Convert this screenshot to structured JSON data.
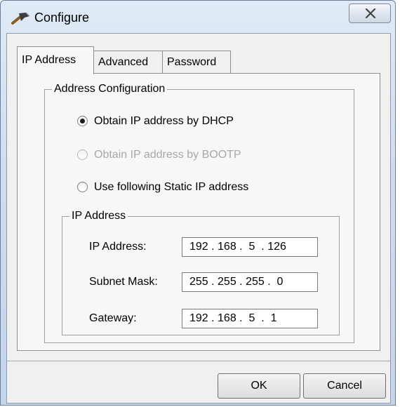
{
  "window": {
    "title": "Configure",
    "icon": "hammer-icon",
    "close_icon": "close-icon"
  },
  "tabs": [
    {
      "label": "IP Address",
      "active": true
    },
    {
      "label": "Advanced",
      "active": false
    },
    {
      "label": "Password",
      "active": false
    }
  ],
  "address_config": {
    "legend": "Address Configuration",
    "options": [
      {
        "label": "Obtain IP address by DHCP",
        "checked": true,
        "enabled": true
      },
      {
        "label": "Obtain IP address by BOOTP",
        "checked": false,
        "enabled": false
      },
      {
        "label": "Use following Static IP address",
        "checked": false,
        "enabled": true
      }
    ]
  },
  "ip_group": {
    "legend": "IP Address",
    "fields": [
      {
        "label": "IP Address:",
        "value": "192 . 168 .  5  . 126"
      },
      {
        "label": "Subnet Mask:",
        "value": "255 . 255 . 255 .  0"
      },
      {
        "label": "Gateway:",
        "value": "192 . 168 .  5  .  1"
      }
    ]
  },
  "buttons": {
    "ok": "OK",
    "cancel": "Cancel"
  }
}
